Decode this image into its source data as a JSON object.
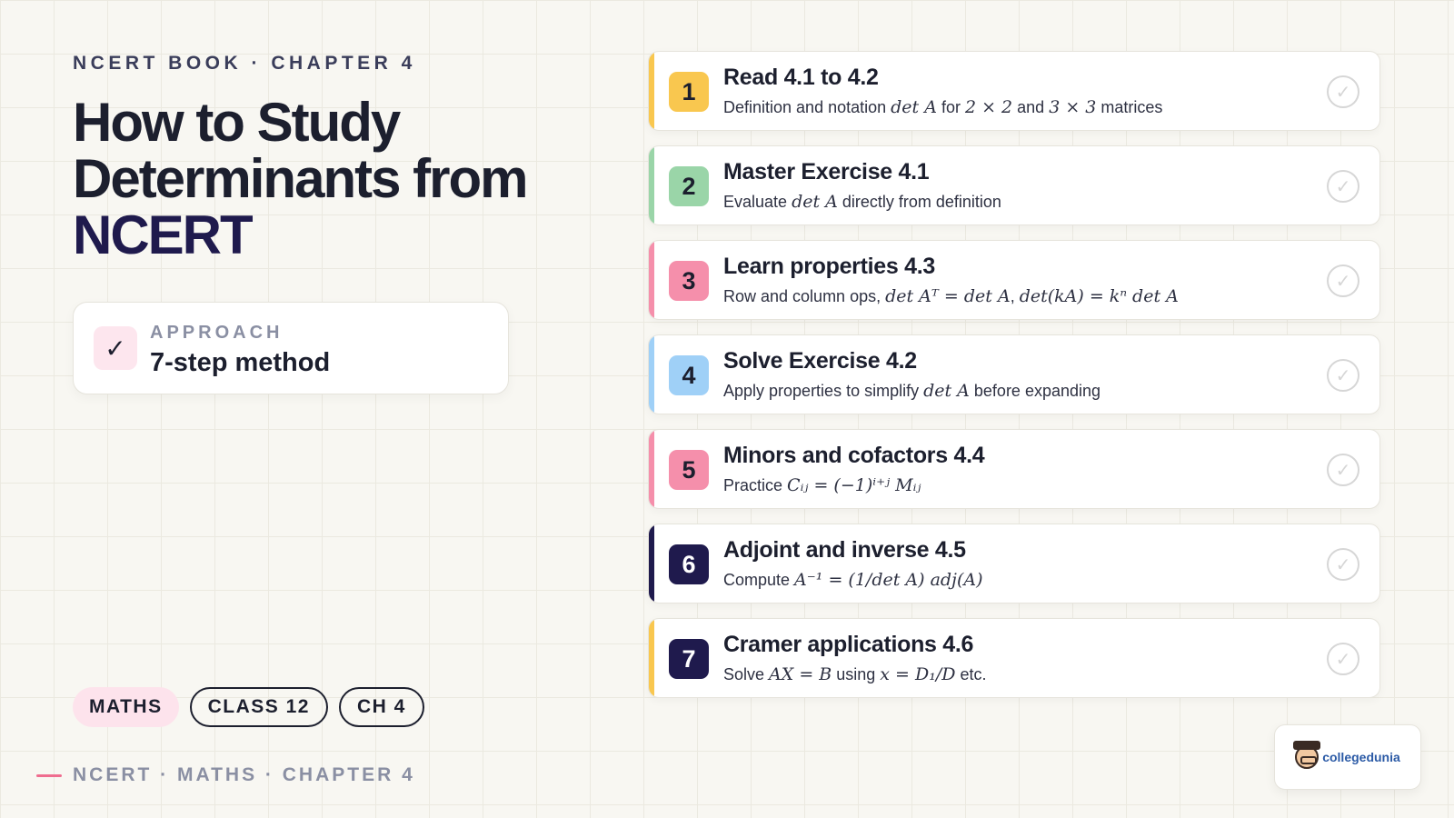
{
  "header": {
    "eyebrow": "NCERT BOOK · CHAPTER 4",
    "title_line1": "How to Study",
    "title_line2": "Determinants from",
    "title_line3": "NCERT"
  },
  "approach": {
    "check": "✓",
    "label": "APPROACH",
    "value": "7-step method"
  },
  "tags": [
    "MATHS",
    "CLASS 12",
    "CH 4"
  ],
  "footer": "NCERT · MATHS · CHAPTER 4",
  "colors": {
    "yellow": "#f9c74f",
    "green": "#9ad5a8",
    "pink": "#f58fab",
    "blue": "#9fd0f7",
    "navy": "#1f1a4d"
  },
  "steps": [
    {
      "num": "1",
      "title": "Read 4.1 to 4.2",
      "desc_a": "Definition and notation ",
      "math_a": "det A",
      "desc_b": " for ",
      "math_b": "2 × 2",
      "desc_c": " and ",
      "math_c": "3 × 3",
      "desc_d": " matrices"
    },
    {
      "num": "2",
      "title": "Master Exercise 4.1",
      "desc_a": "Evaluate ",
      "math_a": "det A",
      "desc_b": " directly from definition"
    },
    {
      "num": "3",
      "title": "Learn properties 4.3",
      "desc_a": "Row and column ops, ",
      "math_a": "det Aᵀ = det A",
      "desc_b": ", ",
      "math_b": "det(kA) = kⁿ det A"
    },
    {
      "num": "4",
      "title": "Solve Exercise 4.2",
      "desc_a": "Apply properties to simplify ",
      "math_a": "det A",
      "desc_b": " before expanding"
    },
    {
      "num": "5",
      "title": "Minors and cofactors 4.4",
      "desc_a": "Practice ",
      "math_a": "Cᵢⱼ = (−1)ⁱ⁺ʲ Mᵢⱼ"
    },
    {
      "num": "6",
      "title": "Adjoint and inverse 4.5",
      "desc_a": "Compute ",
      "math_a": "A⁻¹ = (1/det A) adj(A)"
    },
    {
      "num": "7",
      "title": "Cramer applications 4.6",
      "desc_a": "Solve ",
      "math_a": "AX = B",
      "desc_b": " using ",
      "math_b": "x = D₁/D",
      "desc_c": " etc."
    }
  ],
  "step_done_icon": "✓",
  "logo": {
    "brand": "collegedunia",
    "mascot": "mascot-icon"
  }
}
